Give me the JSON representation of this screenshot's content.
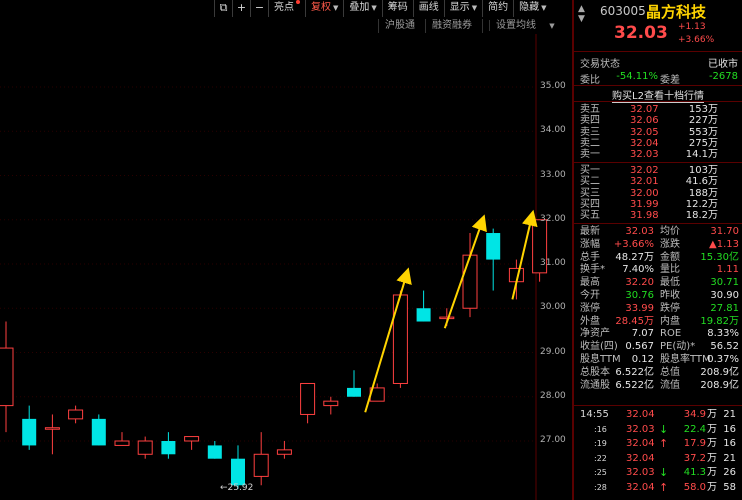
{
  "toolbar": {
    "items": [
      {
        "label": "亮点",
        "dot": true
      },
      {
        "label": "复权",
        "active": true,
        "caret": true
      },
      {
        "label": "叠加",
        "caret": true
      },
      {
        "label": "筹码"
      },
      {
        "label": "画线"
      },
      {
        "label": "显示",
        "caret": true
      },
      {
        "label": "简约"
      },
      {
        "label": "隐藏",
        "caret": true
      }
    ]
  },
  "sub_toolbar": {
    "items": [
      "沪股通",
      "融资融券",
      "设置均线"
    ]
  },
  "chart_data": {
    "type": "candlestick",
    "y_ticks": [
      "35.00",
      "34.00",
      "33.00",
      "32.00",
      "31.00",
      "30.00",
      "29.00",
      "28.00",
      "27.00"
    ],
    "ylim": [
      26.5,
      35.5
    ],
    "candles": [
      {
        "o": 27.8,
        "h": 29.7,
        "l": 27.2,
        "c": 29.1
      },
      {
        "o": 27.5,
        "h": 27.8,
        "l": 26.8,
        "c": 26.9
      },
      {
        "o": 27.3,
        "h": 27.6,
        "l": 26.7,
        "c": 27.3
      },
      {
        "o": 27.5,
        "h": 27.8,
        "l": 27.4,
        "c": 27.7
      },
      {
        "o": 27.5,
        "h": 27.6,
        "l": 26.9,
        "c": 26.9
      },
      {
        "o": 26.9,
        "h": 27.2,
        "l": 26.9,
        "c": 27.0
      },
      {
        "o": 26.7,
        "h": 27.1,
        "l": 26.6,
        "c": 27.0
      },
      {
        "o": 27.0,
        "h": 27.2,
        "l": 26.6,
        "c": 26.7
      },
      {
        "o": 27.0,
        "h": 27.1,
        "l": 26.8,
        "c": 27.1
      },
      {
        "o": 26.9,
        "h": 27.0,
        "l": 26.6,
        "c": 26.6
      },
      {
        "o": 26.6,
        "h": 26.9,
        "l": 25.92,
        "c": 26.0
      },
      {
        "o": 26.2,
        "h": 27.2,
        "l": 26.0,
        "c": 26.7
      },
      {
        "o": 26.7,
        "h": 27.0,
        "l": 26.6,
        "c": 26.8
      },
      {
        "o": 27.6,
        "h": 28.3,
        "l": 27.4,
        "c": 28.3
      },
      {
        "o": 27.8,
        "h": 28.0,
        "l": 27.6,
        "c": 27.9
      },
      {
        "o": 28.2,
        "h": 28.6,
        "l": 28.0,
        "c": 28.0
      },
      {
        "o": 27.9,
        "h": 28.3,
        "l": 27.9,
        "c": 28.2
      },
      {
        "o": 28.3,
        "h": 30.4,
        "l": 28.2,
        "c": 30.3
      },
      {
        "o": 30.0,
        "h": 30.4,
        "l": 29.7,
        "c": 29.7
      },
      {
        "o": 29.8,
        "h": 30.0,
        "l": 29.6,
        "c": 29.8
      },
      {
        "o": 30.0,
        "h": 31.7,
        "l": 29.8,
        "c": 31.2
      },
      {
        "o": 31.7,
        "h": 31.8,
        "l": 30.4,
        "c": 31.1
      },
      {
        "o": 30.6,
        "h": 31.1,
        "l": 30.2,
        "c": 30.9
      },
      {
        "o": 30.8,
        "h": 32.0,
        "l": 30.6,
        "c": 32.0
      }
    ],
    "annotations": [
      {
        "text": "←25.92"
      }
    ],
    "colors": {
      "up": "#ff4040",
      "down": "#00e5e5",
      "arrow": "#ffd400",
      "grid": "#2a0000"
    }
  },
  "quote": {
    "code": "603005",
    "name": "晶方科技",
    "price": "32.03",
    "change": "+1.13",
    "change_pct": "+3.66%",
    "trade_status_label": "交易状态",
    "trade_status": "已收市",
    "weibi_label": "委比",
    "weibi": "-54.11%",
    "weicha_label": "委差",
    "weicha": "-2678",
    "l2_link": "购买L2查看十档行情",
    "asks": [
      {
        "name": "卖五",
        "price": "32.07",
        "vol": "153",
        "unit": "万"
      },
      {
        "name": "卖四",
        "price": "32.06",
        "vol": "227",
        "unit": "万"
      },
      {
        "name": "卖三",
        "price": "32.05",
        "vol": "553",
        "unit": "万"
      },
      {
        "name": "卖二",
        "price": "32.04",
        "vol": "275",
        "unit": "万"
      },
      {
        "name": "卖一",
        "price": "32.03",
        "vol": "14.1",
        "unit": "万"
      }
    ],
    "bids": [
      {
        "name": "买一",
        "price": "32.02",
        "vol": "103",
        "unit": "万"
      },
      {
        "name": "买二",
        "price": "32.01",
        "vol": "41.6",
        "unit": "万"
      },
      {
        "name": "买三",
        "price": "32.00",
        "vol": "188",
        "unit": "万"
      },
      {
        "name": "买四",
        "price": "31.99",
        "vol": "12.2",
        "unit": "万"
      },
      {
        "name": "买五",
        "price": "31.98",
        "vol": "18.2",
        "unit": "万"
      }
    ],
    "stats": [
      {
        "l1": "最新",
        "v1": "32.03",
        "c1": "red",
        "l2": "均价",
        "v2": "31.70",
        "c2": "red"
      },
      {
        "l1": "涨幅",
        "v1": "+3.66%",
        "c1": "red",
        "l2": "涨跌",
        "v2": "▲1.13",
        "c2": "red"
      },
      {
        "l1": "总手",
        "v1": "48.27万",
        "c1": "white",
        "l2": "金额",
        "v2": "15.30亿",
        "c2": "green"
      },
      {
        "l1": "换手*",
        "v1": "7.40%",
        "c1": "white",
        "l2": "量比",
        "v2": "1.11",
        "c2": "red"
      },
      {
        "l1": "最高",
        "v1": "32.20",
        "c1": "red",
        "l2": "最低",
        "v2": "30.71",
        "c2": "green"
      },
      {
        "l1": "今开",
        "v1": "30.76",
        "c1": "green",
        "l2": "昨收",
        "v2": "30.90",
        "c2": "white"
      },
      {
        "l1": "涨停",
        "v1": "33.99",
        "c1": "red",
        "l2": "跌停",
        "v2": "27.81",
        "c2": "green"
      },
      {
        "l1": "外盘",
        "v1": "28.45万",
        "c1": "red",
        "l2": "内盘",
        "v2": "19.82万",
        "c2": "green"
      },
      {
        "l1": "净资产",
        "v1": "7.07",
        "c1": "white",
        "l2": "ROE",
        "v2": "8.33%",
        "c2": "white"
      },
      {
        "l1": "收益(四)",
        "v1": "0.567",
        "c1": "white",
        "l2": "PE(动)*",
        "v2": "56.52",
        "c2": "white"
      },
      {
        "l1": "股息TTM",
        "v1": "0.12",
        "c1": "white",
        "l2": "股息率TTM",
        "v2": "0.37%",
        "c2": "white"
      },
      {
        "l1": "总股本",
        "v1": "6.522亿",
        "c1": "white",
        "l2": "总值",
        "v2": "208.9亿",
        "c2": "white"
      },
      {
        "l1": "流通股",
        "v1": "6.522亿",
        "c1": "white",
        "l2": "流值",
        "v2": "208.9亿",
        "c2": "white"
      }
    ],
    "ticks": [
      {
        "time": "14:55",
        "small": false,
        "price": "32.04",
        "pc": "red",
        "arrow": "",
        "ac": "",
        "vol": "34.9",
        "vc": "red",
        "unit": "万",
        "count": "21"
      },
      {
        "time": ":16",
        "small": true,
        "price": "32.03",
        "pc": "red",
        "arrow": "↓",
        "ac": "green",
        "vol": "22.4",
        "vc": "green",
        "unit": "万",
        "count": "16"
      },
      {
        "time": ":19",
        "small": true,
        "price": "32.04",
        "pc": "red",
        "arrow": "↑",
        "ac": "red",
        "vol": "17.9",
        "vc": "red",
        "unit": "万",
        "count": "16"
      },
      {
        "time": ":22",
        "small": true,
        "price": "32.04",
        "pc": "red",
        "arrow": "",
        "ac": "",
        "vol": "37.2",
        "vc": "red",
        "unit": "万",
        "count": "21"
      },
      {
        "time": ":25",
        "small": true,
        "price": "32.03",
        "pc": "red",
        "arrow": "↓",
        "ac": "green",
        "vol": "41.3",
        "vc": "green",
        "unit": "万",
        "count": "26"
      },
      {
        "time": ":28",
        "small": true,
        "price": "32.04",
        "pc": "red",
        "arrow": "↑",
        "ac": "red",
        "vol": "58.0",
        "vc": "red",
        "unit": "万",
        "count": "58"
      }
    ]
  }
}
